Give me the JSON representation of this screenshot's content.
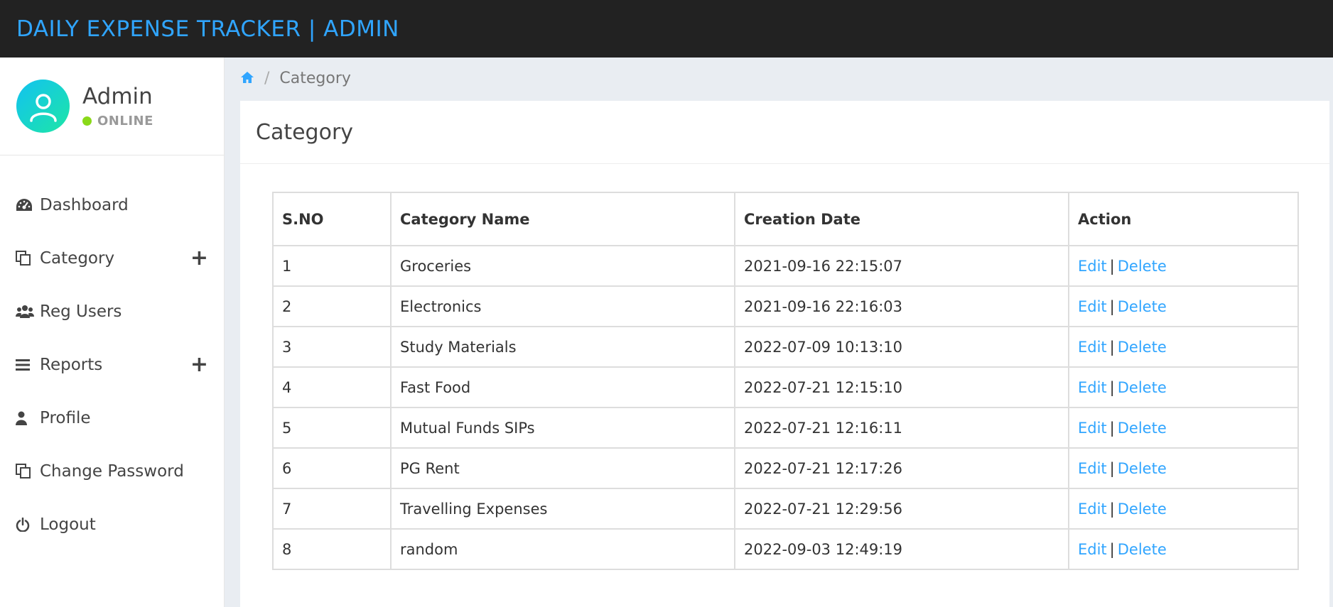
{
  "brand": {
    "title": "DAILY EXPENSE TRACKER | ADMIN",
    "color": "#30a5ff"
  },
  "profile": {
    "name": "Admin",
    "status": "ONLINE"
  },
  "sidebar": {
    "items": [
      {
        "label": "Dashboard",
        "icon": "dashboard-icon",
        "expandable": false
      },
      {
        "label": "Category",
        "icon": "copy-icon",
        "expandable": true
      },
      {
        "label": "Reg Users",
        "icon": "users-icon",
        "expandable": false
      },
      {
        "label": "Reports",
        "icon": "bars-icon",
        "expandable": true
      },
      {
        "label": "Profile",
        "icon": "user-icon",
        "expandable": false
      },
      {
        "label": "Change Password",
        "icon": "copy-icon",
        "expandable": false
      },
      {
        "label": "Logout",
        "icon": "power-icon",
        "expandable": false
      }
    ],
    "expand_symbol": "+"
  },
  "breadcrumb": {
    "separator": "/",
    "current": "Category"
  },
  "panel": {
    "title": "Category"
  },
  "table": {
    "headers": [
      "S.NO",
      "Category Name",
      "Creation Date",
      "Action"
    ],
    "rows": [
      {
        "sno": "1",
        "name": "Groceries",
        "date": "2021-09-16 22:15:07"
      },
      {
        "sno": "2",
        "name": "Electronics",
        "date": "2021-09-16 22:16:03"
      },
      {
        "sno": "3",
        "name": "Study Materials",
        "date": "2022-07-09 10:13:10"
      },
      {
        "sno": "4",
        "name": "Fast Food",
        "date": "2022-07-21 12:15:10"
      },
      {
        "sno": "5",
        "name": "Mutual Funds SIPs",
        "date": "2022-07-21 12:16:11"
      },
      {
        "sno": "6",
        "name": "PG Rent",
        "date": "2022-07-21 12:17:26"
      },
      {
        "sno": "7",
        "name": "Travelling Expenses",
        "date": "2022-07-21 12:29:56"
      },
      {
        "sno": "8",
        "name": "random",
        "date": "2022-09-03 12:49:19"
      }
    ],
    "edit_label": "Edit",
    "delete_label": "Delete",
    "action_separator": "|"
  }
}
